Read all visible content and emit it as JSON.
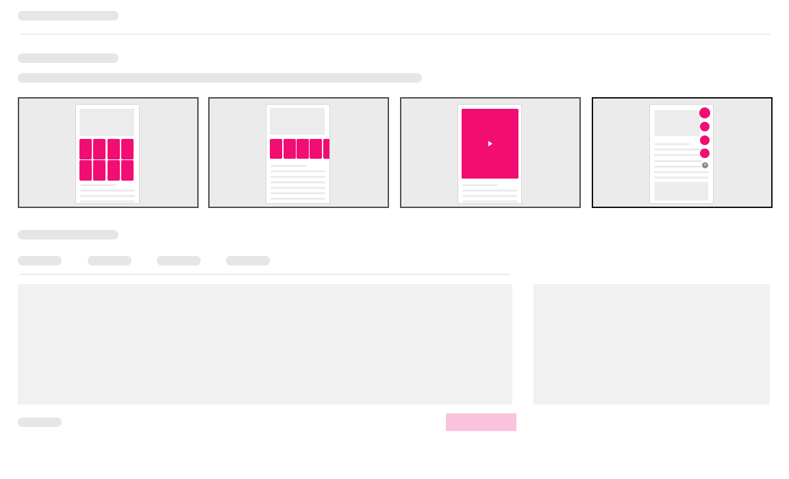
{
  "colors": {
    "accent": "#f20d72",
    "accent_light": "#f9c3dc",
    "skeleton": "#e6e6e6",
    "divider": "#ececec",
    "panel": "#f1f1f1",
    "card_bg": "#ebebeb",
    "card_border": "#505050",
    "card_border_selected": "#111111"
  },
  "icons": {
    "play": "play-icon",
    "close": "close-icon"
  },
  "layouts": [
    {
      "id": "grid",
      "selected": false
    },
    {
      "id": "carousel",
      "selected": false
    },
    {
      "id": "video",
      "selected": false
    },
    {
      "id": "floating-bubbles",
      "selected": true
    }
  ],
  "tabs": [
    {
      "id": "tab-1"
    },
    {
      "id": "tab-2"
    },
    {
      "id": "tab-3"
    },
    {
      "id": "tab-4"
    }
  ]
}
